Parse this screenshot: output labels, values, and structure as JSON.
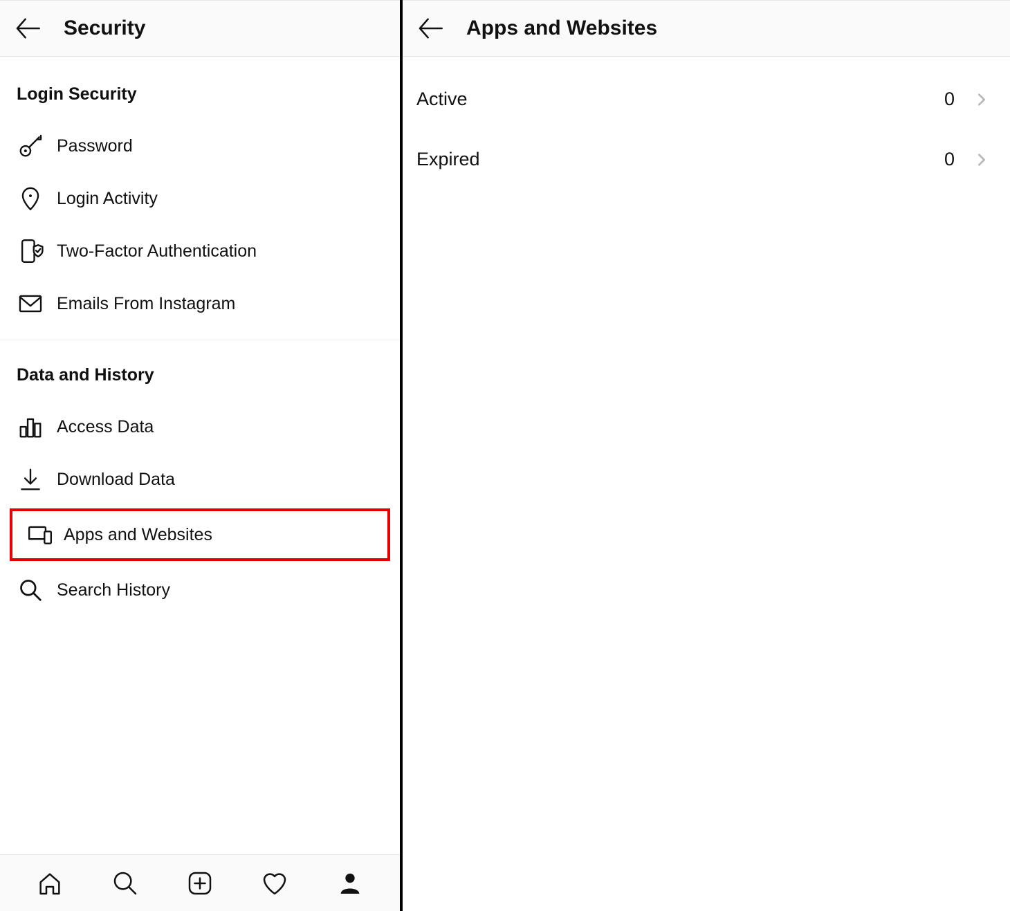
{
  "left": {
    "title": "Security",
    "sections": [
      {
        "heading": "Login Security",
        "items": [
          {
            "label": "Password"
          },
          {
            "label": "Login Activity"
          },
          {
            "label": "Two-Factor Authentication"
          },
          {
            "label": "Emails From Instagram"
          }
        ]
      },
      {
        "heading": "Data and History",
        "items": [
          {
            "label": "Access Data"
          },
          {
            "label": "Download Data"
          },
          {
            "label": "Apps and Websites"
          },
          {
            "label": "Search History"
          }
        ]
      }
    ]
  },
  "right": {
    "title": "Apps and Websites",
    "rows": [
      {
        "label": "Active",
        "count": "0"
      },
      {
        "label": "Expired",
        "count": "0"
      }
    ]
  }
}
